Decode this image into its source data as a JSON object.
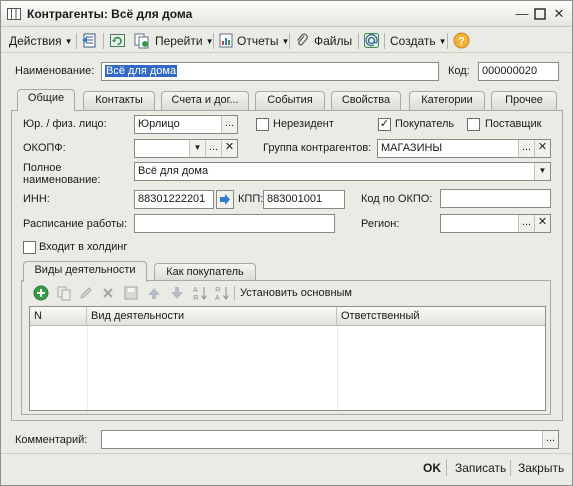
{
  "window": {
    "title": "Контрагенты: Всё для дома"
  },
  "toolbar": {
    "actions": "Действия",
    "goto": "Перейти",
    "reports": "Отчеты",
    "files": "Файлы",
    "create": "Создать"
  },
  "header": {
    "name_label": "Наименование:",
    "name_value": "Всё для дома",
    "code_label": "Код:",
    "code_value": "000000020"
  },
  "tabs": [
    {
      "label": "Общие"
    },
    {
      "label": "Контакты"
    },
    {
      "label": "Счета и дог..."
    },
    {
      "label": "События"
    },
    {
      "label": "Свойства"
    },
    {
      "label": "Категории"
    },
    {
      "label": "Прочее"
    }
  ],
  "general": {
    "legal_label": "Юр. / физ. лицо:",
    "legal_value": "Юрлицо",
    "nonresident_label": "Нерезидент",
    "nonresident_checked": false,
    "buyer_label": "Покупатель",
    "buyer_checked": true,
    "supplier_label": "Поставщик",
    "supplier_checked": false,
    "okopf_label": "ОКОПФ:",
    "okopf_value": "",
    "group_label": "Группа контрагентов:",
    "group_value": "МАГАЗИНЫ",
    "fullname_label_1": "Полное",
    "fullname_label_2": "наименование:",
    "fullname_value": "Всё для дома",
    "inn_label": "ИНН:",
    "inn_value": "88301222201",
    "kpp_label": "КПП:",
    "kpp_value": "883001001",
    "okpo_label": "Код по ОКПО:",
    "okpo_value": "",
    "schedule_label": "Расписание работы:",
    "schedule_value": "",
    "region_label": "Регион:",
    "region_value": "",
    "holding_label": "Входит в холдинг",
    "holding_checked": false
  },
  "subtabs": [
    {
      "label": "Виды деятельности"
    },
    {
      "label": "Как покупатель"
    }
  ],
  "activity": {
    "set_main_label": "Установить основным",
    "columns": [
      "N",
      "Вид деятельности",
      "Ответственный"
    ],
    "rows": []
  },
  "comment": {
    "label": "Комментарий:",
    "value": ""
  },
  "footer": {
    "ok": "OK",
    "save": "Записать",
    "close": "Закрыть"
  },
  "colors": {
    "selection": "#316ac5",
    "window_bg": "#ebebe6"
  }
}
